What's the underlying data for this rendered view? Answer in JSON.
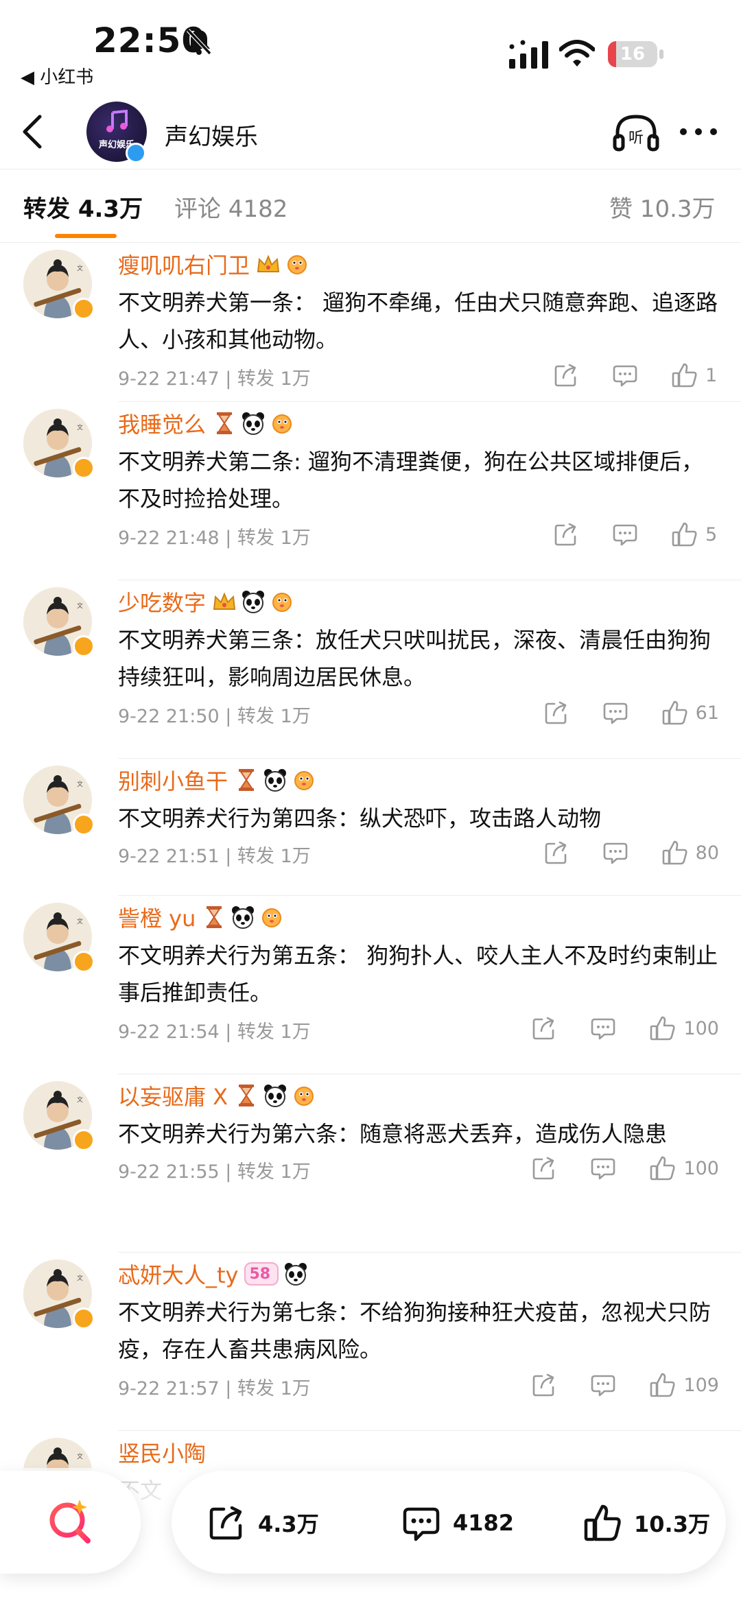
{
  "status_bar": {
    "time": "22:50",
    "back_app": "◀ 小红书",
    "battery": "16",
    "battery_level_percent": 16
  },
  "nav": {
    "account_name": "声幻娱乐",
    "logo_text": "声幻娱乐"
  },
  "tabs": {
    "reposts": "转发 4.3万",
    "comments": "评论 4182",
    "likes": "赞 10.3万"
  },
  "items": [
    {
      "username": "瘦叽叽右门卫",
      "badges": [
        "crown-icon",
        "pufferfish-icon"
      ],
      "content": "不文明养犬第一条： 遛狗不牵绳，任由犬只随意奔跑、追逐路人、小孩和其他动物。",
      "meta": "9-22 21:47 | 转发 1万",
      "likes": "1"
    },
    {
      "username": "我睡觉么",
      "badges": [
        "hourglass-icon",
        "panda-icon",
        "pufferfish-icon"
      ],
      "content": "不文明养犬第二条: 遛狗不清理粪便，狗在公共区域排便后，不及时捡拾处理。",
      "meta": "9-22 21:48 | 转发 1万",
      "likes": "5"
    },
    {
      "username": "少吃数字",
      "badges": [
        "crown-icon",
        "panda-icon",
        "pufferfish-icon"
      ],
      "content": "不文明养犬第三条：放任犬只吠叫扰民，深夜、清晨任由狗狗持续狂叫，影响周边居民休息。",
      "meta": "9-22 21:50 | 转发 1万",
      "likes": "61"
    },
    {
      "username": "别刺小鱼干",
      "badges": [
        "hourglass-icon",
        "panda-icon",
        "pufferfish-icon"
      ],
      "content": "不文明养犬行为第四条：纵犬恐吓，攻击路人动物",
      "meta": "9-22 21:51 | 转发 1万",
      "likes": "80"
    },
    {
      "username": "訾橙 yu",
      "badges": [
        "hourglass-icon",
        "panda-icon",
        "pufferfish-icon"
      ],
      "content": "不文明养犬行为第五条： 狗狗扑人、咬人主人不及时约束制止事后推卸责任。",
      "meta": "9-22 21:54 | 转发 1万",
      "likes": "100"
    },
    {
      "username": "以妄驱庸 X",
      "badges": [
        "hourglass-icon",
        "panda-icon",
        "pufferfish-icon"
      ],
      "content": "不文明养犬行为第六条：随意将恶犬丢弃，造成伤人隐患",
      "meta": "9-22 21:55 | 转发 1万",
      "likes": "100"
    },
    {
      "username": "忒妍大人_ty",
      "badges": [
        "level-badge-icon",
        "panda-icon"
      ],
      "level_badge": "58",
      "content": "不文明养犬行为第七条：不给狗狗接种狂犬疫苗，忽视犬只防疫，存在人畜共患病风险。",
      "meta": "9-22 21:57 | 转发 1万",
      "likes": "109"
    },
    {
      "username": "竖民小陶",
      "badges": [],
      "content": "不文",
      "meta": "",
      "likes": ""
    }
  ],
  "bottom_bar": {
    "reposts": "4.3万",
    "comments": "4182",
    "likes": "10.3万"
  },
  "colors": {
    "accent": "#ff8200",
    "username": "#e86a1a",
    "verified_blue": "#2d9cf0",
    "verified_orange": "#f7a51c",
    "meta_grey": "#999999",
    "battery_red": "#e8444c"
  }
}
